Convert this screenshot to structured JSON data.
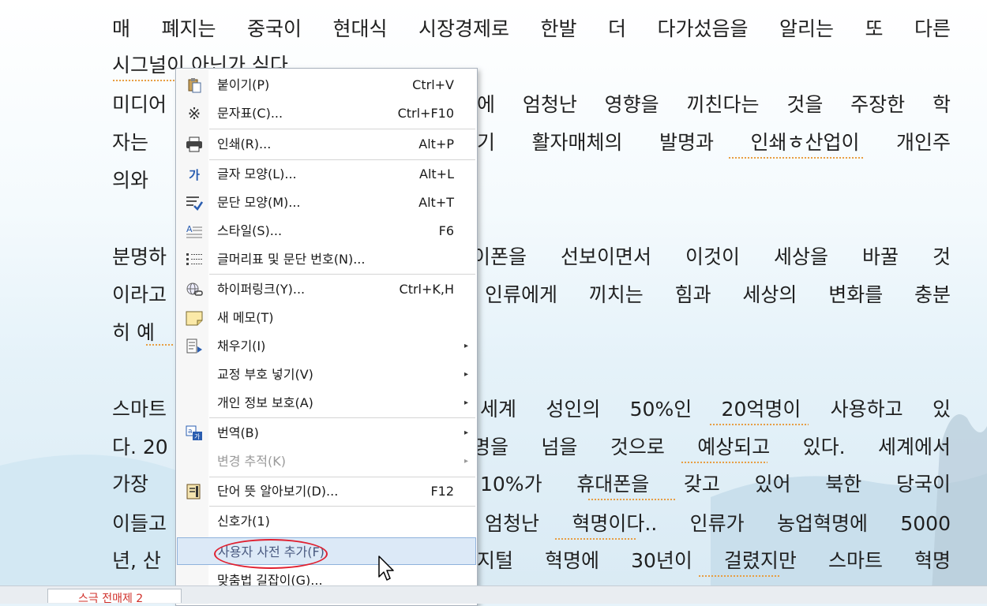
{
  "document": {
    "lines": [
      "매 폐지는 중국이 현대식 시장경제로 한발 더 다가섰음을 알리는 또 다른",
      "시그널이 아닌가 싶다.",
      "미디어",
      "에 엄청난 영향을 끼친다는 것을 주장한 학",
      "자는",
      "기 활자매체의 발명과 인쇄ㅎ산업이 개인주",
      "의와",
      "분명하",
      "이폰을 선보이면서 이것이 세상을 바꿀 것",
      "이라고",
      "인류에게 끼치는 힘과 세상의 변화를 충분",
      "히 예",
      "스마트",
      "세계 성인의 50%인 20억명이 사용하고 있",
      "다. 20",
      "명을 넘을 것으로 예상되고 있다. 세계에서",
      "가장",
      "10%가 휴대폰을 갖고 있어 북한 당국이",
      "이들고",
      "엄청난 혁명이다.. 인류가 농업혁명에 5000",
      "년, 산",
      "지털 혁명에 30년이 걸렸지만 스마트 혁명"
    ]
  },
  "context_menu": {
    "items": [
      {
        "icon": "paste-icon",
        "label": "붙이기(P)",
        "shortcut": "Ctrl+V"
      },
      {
        "icon": "symbol-icon",
        "label": "문자표(C)...",
        "shortcut": "Ctrl+F10"
      },
      {
        "icon": "printer-icon",
        "label": "인쇄(R)...",
        "shortcut": "Alt+P"
      },
      {
        "icon": "char-shape-icon",
        "label": "글자 모양(L)...",
        "shortcut": "Alt+L"
      },
      {
        "icon": "para-shape-icon",
        "label": "문단 모양(M)...",
        "shortcut": "Alt+T"
      },
      {
        "icon": "style-icon",
        "label": "스타일(S)...",
        "shortcut": "F6"
      },
      {
        "icon": "bullet-list-icon",
        "label": "글머리표 및 문단 번호(N)...",
        "shortcut": ""
      },
      {
        "icon": "hyperlink-icon",
        "label": "하이퍼링크(Y)...",
        "shortcut": "Ctrl+K,H"
      },
      {
        "icon": "memo-icon",
        "label": "새 메모(T)",
        "shortcut": ""
      },
      {
        "icon": "fill-icon",
        "label": "채우기(I)",
        "shortcut": "",
        "submenu": "▸"
      },
      {
        "icon": "",
        "label": "교정 부호 넣기(V)",
        "shortcut": "",
        "submenu": "▸"
      },
      {
        "icon": "",
        "label": "개인 정보 보호(A)",
        "shortcut": "",
        "submenu": "▸"
      },
      {
        "icon": "translate-icon",
        "label": "번역(B)",
        "shortcut": "",
        "submenu": "▸"
      },
      {
        "icon": "",
        "label": "변경 추적(K)",
        "shortcut": "",
        "submenu": "▸",
        "disabled": true
      },
      {
        "icon": "dictionary-icon",
        "label": "단어 뜻 알아보기(D)...",
        "shortcut": "F12"
      },
      {
        "icon": "",
        "label": "신호가(1)",
        "shortcut": ""
      },
      {
        "icon": "",
        "label": "사용자 사전 추가(F)",
        "shortcut": "",
        "highlighted": true
      },
      {
        "icon": "",
        "label": "맞춤법 길잡이(G)...",
        "shortcut": ""
      }
    ]
  },
  "bottom_tab": {
    "label": "스극 전매제 2"
  },
  "colors": {
    "highlight": "#dce9f7",
    "annotation": "#e02030",
    "spell_underline": "#e79a3a"
  }
}
